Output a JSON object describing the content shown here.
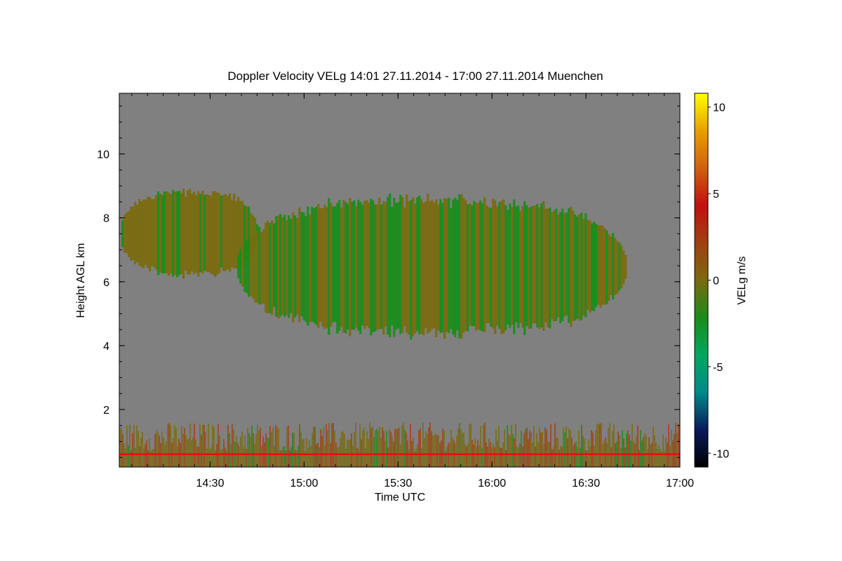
{
  "chart_data": {
    "type": "heatmap",
    "title": "Doppler Velocity VELg   14:01 27.11.2014 - 17:00 27.11.2014 Muenchen",
    "xlabel": "Time UTC",
    "ylabel": "Height AGL km",
    "x_range": [
      "14:01",
      "17:00"
    ],
    "y_range_km": [
      0.2,
      11.9
    ],
    "x_ticks": [
      "14:30",
      "15:00",
      "15:30",
      "16:00",
      "16:30",
      "17:00"
    ],
    "y_ticks": [
      "2",
      "4",
      "6",
      "8",
      "10"
    ],
    "colorbar": {
      "label": "VELg m/s",
      "min": -10.8,
      "max": 10.8,
      "ticks": [
        "10",
        "5",
        "0",
        "-5",
        "-10"
      ],
      "colors": [
        "#000000",
        "#0a1a5a",
        "#008a8a",
        "#00a860",
        "#1a8c1a",
        "#7a6a10",
        "#a04010",
        "#c01010",
        "#d06010",
        "#e8a000",
        "#ffff00"
      ]
    },
    "background_color": "#808080",
    "features": [
      {
        "kind": "cloud",
        "t_start": "14:01",
        "t_end": "14:45",
        "h_bottom_km": 6.1,
        "h_top_km": 8.9,
        "velocity_ms": -0.5
      },
      {
        "kind": "cloud",
        "t_start": "14:38",
        "t_end": "16:43",
        "h_bottom_km": 4.2,
        "h_top_km": 8.7,
        "velocity_ms": -1.0
      },
      {
        "kind": "noise_band",
        "t_start": "14:01",
        "t_end": "17:00",
        "h_bottom_km": 0.2,
        "h_top_km": 1.6,
        "velocity_ms": 0.5
      },
      {
        "kind": "reference_line",
        "height_km": 0.6,
        "color": "#e01010"
      }
    ]
  }
}
